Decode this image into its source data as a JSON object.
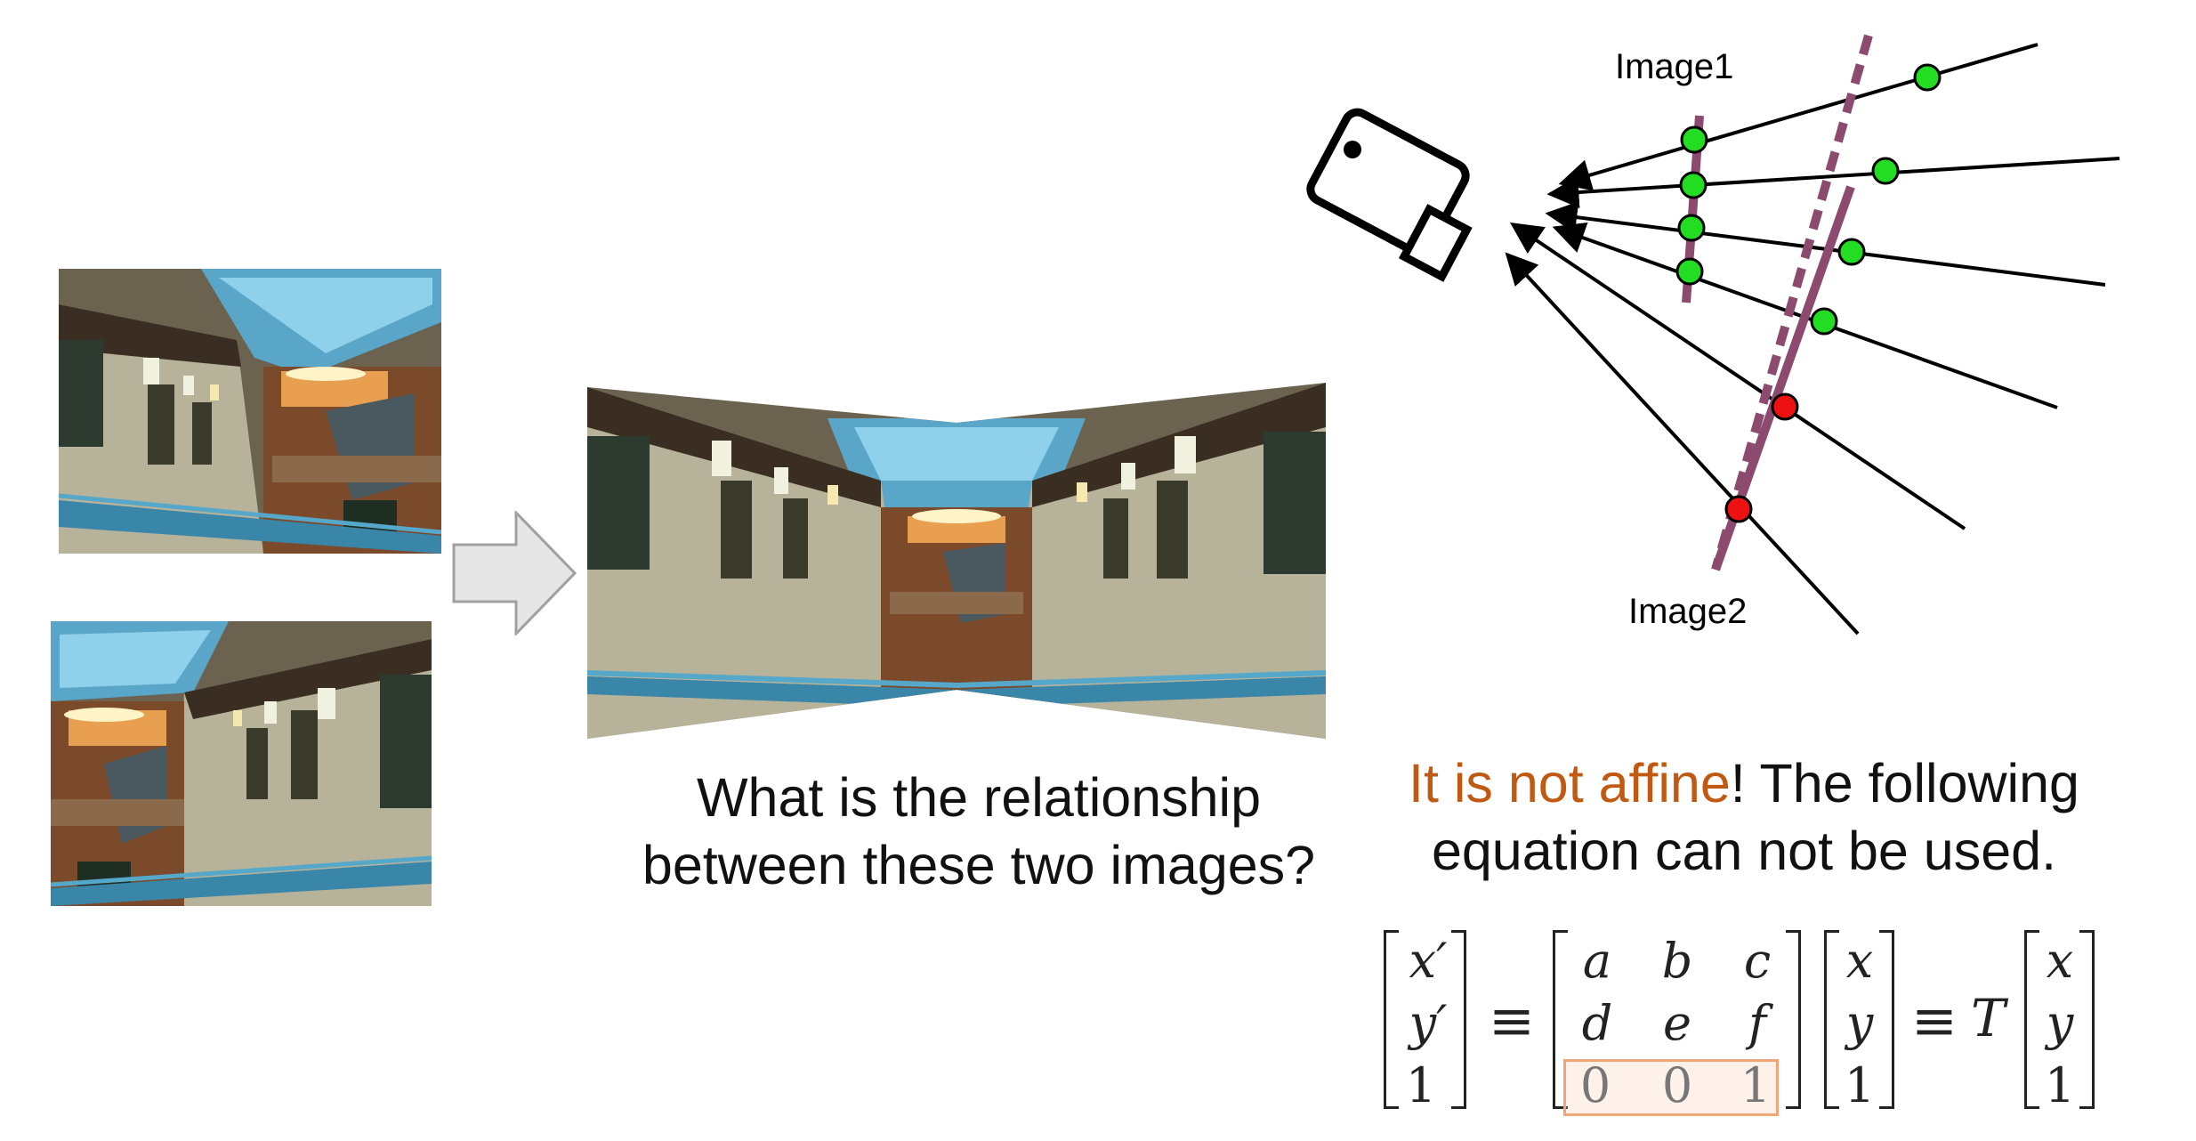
{
  "question": {
    "line1": "What is the relationship",
    "line2": "between these two images?"
  },
  "statement": {
    "highlight": "It is not affine",
    "rest_line1": "! The following",
    "line2": "equation can not be used."
  },
  "diagram": {
    "label_image1": "Image1",
    "label_image2": "Image2",
    "ray_color": "#000000",
    "plane_color": "#8c4a6e",
    "green_point_color": "#22dd22",
    "red_point_color": "#ee1111"
  },
  "equation": {
    "lhs": [
      "x′",
      "y′",
      "1"
    ],
    "matrix": [
      [
        "a",
        "b",
        "c"
      ],
      [
        "d",
        "e",
        "f"
      ],
      [
        "0",
        "0",
        "1"
      ]
    ],
    "vec": [
      "x",
      "y",
      "1"
    ],
    "equiv": "≡",
    "T": "T",
    "highlight_row_color": "#f0a577"
  },
  "colors": {
    "arrow_fill": "#e6e6e6",
    "arrow_stroke": "#a0a0a0",
    "highlight_text": "#c05a12"
  }
}
